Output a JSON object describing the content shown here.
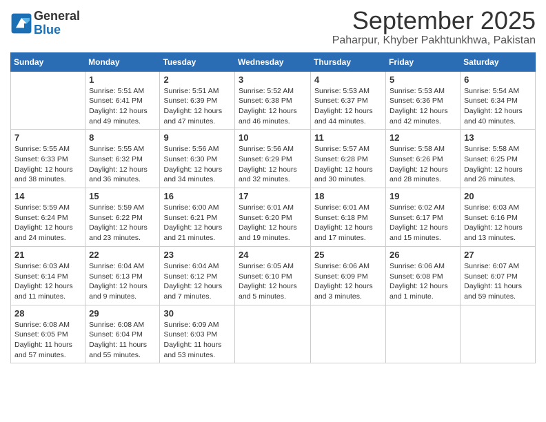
{
  "logo": {
    "line1": "General",
    "line2": "Blue"
  },
  "title": "September 2025",
  "location": "Paharpur, Khyber Pakhtunkhwa, Pakistan",
  "columns": [
    "Sunday",
    "Monday",
    "Tuesday",
    "Wednesday",
    "Thursday",
    "Friday",
    "Saturday"
  ],
  "weeks": [
    [
      {
        "day": "",
        "info": ""
      },
      {
        "day": "1",
        "info": "Sunrise: 5:51 AM\nSunset: 6:41 PM\nDaylight: 12 hours\nand 49 minutes."
      },
      {
        "day": "2",
        "info": "Sunrise: 5:51 AM\nSunset: 6:39 PM\nDaylight: 12 hours\nand 47 minutes."
      },
      {
        "day": "3",
        "info": "Sunrise: 5:52 AM\nSunset: 6:38 PM\nDaylight: 12 hours\nand 46 minutes."
      },
      {
        "day": "4",
        "info": "Sunrise: 5:53 AM\nSunset: 6:37 PM\nDaylight: 12 hours\nand 44 minutes."
      },
      {
        "day": "5",
        "info": "Sunrise: 5:53 AM\nSunset: 6:36 PM\nDaylight: 12 hours\nand 42 minutes."
      },
      {
        "day": "6",
        "info": "Sunrise: 5:54 AM\nSunset: 6:34 PM\nDaylight: 12 hours\nand 40 minutes."
      }
    ],
    [
      {
        "day": "7",
        "info": "Sunrise: 5:55 AM\nSunset: 6:33 PM\nDaylight: 12 hours\nand 38 minutes."
      },
      {
        "day": "8",
        "info": "Sunrise: 5:55 AM\nSunset: 6:32 PM\nDaylight: 12 hours\nand 36 minutes."
      },
      {
        "day": "9",
        "info": "Sunrise: 5:56 AM\nSunset: 6:30 PM\nDaylight: 12 hours\nand 34 minutes."
      },
      {
        "day": "10",
        "info": "Sunrise: 5:56 AM\nSunset: 6:29 PM\nDaylight: 12 hours\nand 32 minutes."
      },
      {
        "day": "11",
        "info": "Sunrise: 5:57 AM\nSunset: 6:28 PM\nDaylight: 12 hours\nand 30 minutes."
      },
      {
        "day": "12",
        "info": "Sunrise: 5:58 AM\nSunset: 6:26 PM\nDaylight: 12 hours\nand 28 minutes."
      },
      {
        "day": "13",
        "info": "Sunrise: 5:58 AM\nSunset: 6:25 PM\nDaylight: 12 hours\nand 26 minutes."
      }
    ],
    [
      {
        "day": "14",
        "info": "Sunrise: 5:59 AM\nSunset: 6:24 PM\nDaylight: 12 hours\nand 24 minutes."
      },
      {
        "day": "15",
        "info": "Sunrise: 5:59 AM\nSunset: 6:22 PM\nDaylight: 12 hours\nand 23 minutes."
      },
      {
        "day": "16",
        "info": "Sunrise: 6:00 AM\nSunset: 6:21 PM\nDaylight: 12 hours\nand 21 minutes."
      },
      {
        "day": "17",
        "info": "Sunrise: 6:01 AM\nSunset: 6:20 PM\nDaylight: 12 hours\nand 19 minutes."
      },
      {
        "day": "18",
        "info": "Sunrise: 6:01 AM\nSunset: 6:18 PM\nDaylight: 12 hours\nand 17 minutes."
      },
      {
        "day": "19",
        "info": "Sunrise: 6:02 AM\nSunset: 6:17 PM\nDaylight: 12 hours\nand 15 minutes."
      },
      {
        "day": "20",
        "info": "Sunrise: 6:03 AM\nSunset: 6:16 PM\nDaylight: 12 hours\nand 13 minutes."
      }
    ],
    [
      {
        "day": "21",
        "info": "Sunrise: 6:03 AM\nSunset: 6:14 PM\nDaylight: 12 hours\nand 11 minutes."
      },
      {
        "day": "22",
        "info": "Sunrise: 6:04 AM\nSunset: 6:13 PM\nDaylight: 12 hours\nand 9 minutes."
      },
      {
        "day": "23",
        "info": "Sunrise: 6:04 AM\nSunset: 6:12 PM\nDaylight: 12 hours\nand 7 minutes."
      },
      {
        "day": "24",
        "info": "Sunrise: 6:05 AM\nSunset: 6:10 PM\nDaylight: 12 hours\nand 5 minutes."
      },
      {
        "day": "25",
        "info": "Sunrise: 6:06 AM\nSunset: 6:09 PM\nDaylight: 12 hours\nand 3 minutes."
      },
      {
        "day": "26",
        "info": "Sunrise: 6:06 AM\nSunset: 6:08 PM\nDaylight: 12 hours\nand 1 minute."
      },
      {
        "day": "27",
        "info": "Sunrise: 6:07 AM\nSunset: 6:07 PM\nDaylight: 11 hours\nand 59 minutes."
      }
    ],
    [
      {
        "day": "28",
        "info": "Sunrise: 6:08 AM\nSunset: 6:05 PM\nDaylight: 11 hours\nand 57 minutes."
      },
      {
        "day": "29",
        "info": "Sunrise: 6:08 AM\nSunset: 6:04 PM\nDaylight: 11 hours\nand 55 minutes."
      },
      {
        "day": "30",
        "info": "Sunrise: 6:09 AM\nSunset: 6:03 PM\nDaylight: 11 hours\nand 53 minutes."
      },
      {
        "day": "",
        "info": ""
      },
      {
        "day": "",
        "info": ""
      },
      {
        "day": "",
        "info": ""
      },
      {
        "day": "",
        "info": ""
      }
    ]
  ]
}
